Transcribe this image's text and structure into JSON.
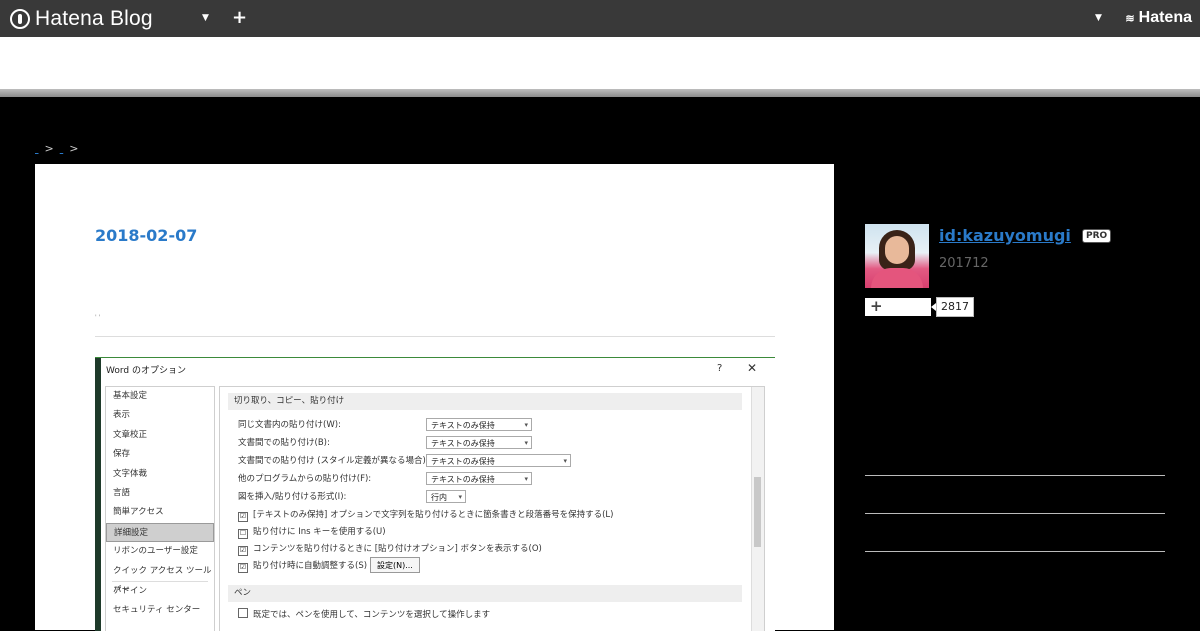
{
  "topbar": {
    "logo_text": "Hatena Blog",
    "brand_right": "Hatena"
  },
  "breadcrumb": {
    "separator": ">"
  },
  "article": {
    "date": "2018-02-07",
    "ticks": "' '"
  },
  "dialog": {
    "title": "Word のオプション",
    "help": "?",
    "close": "✕",
    "nav": [
      "基本設定",
      "表示",
      "文章校正",
      "保存",
      "文字体裁",
      "言語",
      "簡単アクセス",
      "詳細設定",
      "リボンのユーザー設定",
      "クイック アクセス ツール バー",
      "アドイン",
      "セキュリティ センター"
    ],
    "active_index": 7,
    "section1": "切り取り、コピー、貼り付け",
    "rows": [
      {
        "label": "同じ文書内の貼り付け(W):",
        "value": "テキストのみ保持"
      },
      {
        "label": "文書間での貼り付け(B):",
        "value": "テキストのみ保持"
      },
      {
        "label": "文書間での貼り付け (スタイル定義が異なる場合)(E):",
        "value": "テキストのみ保持"
      },
      {
        "label": "他のプログラムからの貼り付け(F):",
        "value": "テキストのみ保持"
      },
      {
        "label": "図を挿入/貼り付ける形式(I):",
        "value": "行内"
      }
    ],
    "checks": [
      {
        "label": "[テキストのみ保持] オプションで文字列を貼り付けるときに箇条書きと段落番号を保持する(L)",
        "checked": "☑"
      },
      {
        "label": "貼り付けに Ins キーを使用する(U)",
        "checked": "☐"
      },
      {
        "label": "コンテンツを貼り付けるときに [貼り付けオプション] ボタンを表示する(O)",
        "checked": "☑"
      },
      {
        "label": "貼り付け時に自動調整する(S)",
        "checked": "☑"
      }
    ],
    "settings_button": "設定(N)...",
    "section2": "ペン",
    "pen_check": "既定では、ペンを使用して、コンテンツを選択して操作します"
  },
  "profile": {
    "user_id": "id:kazuyomugi",
    "badge": "PRO",
    "since": "201712",
    "follow_label": "+",
    "follower_count": "2817"
  }
}
